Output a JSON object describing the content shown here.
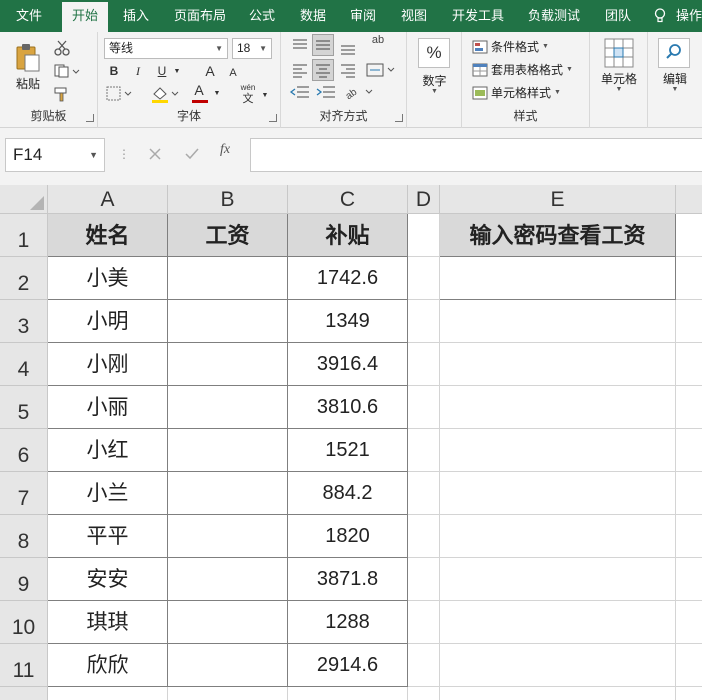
{
  "tabs": [
    "文件",
    "开始",
    "插入",
    "页面布局",
    "公式",
    "数据",
    "审阅",
    "视图",
    "开发工具",
    "负载测试",
    "团队",
    "操作"
  ],
  "active_tab": "开始",
  "clipboard": {
    "paste_label": "粘贴",
    "group_label": "剪贴板"
  },
  "font": {
    "name": "等线",
    "size": "18",
    "bold": "B",
    "italic": "I",
    "underline": "U",
    "grow": "A",
    "shrink": "A",
    "phonetic_top": "wén",
    "phonetic_bottom": "文",
    "font_color": "A",
    "group_label": "字体"
  },
  "alignment": {
    "wrap_icon": "ab",
    "group_label": "对齐方式"
  },
  "number": {
    "symbol": "%",
    "label": "数字"
  },
  "styles": {
    "conditional": "条件格式",
    "table_format": "套用表格格式",
    "cell_styles": "单元格样式",
    "group_label": "样式"
  },
  "cells": {
    "label": "单元格"
  },
  "editing": {
    "label": "编辑"
  },
  "formula_bar": {
    "name_box": "F14",
    "fx": "fx",
    "formula": ""
  },
  "columns": [
    "A",
    "B",
    "C",
    "D",
    "E"
  ],
  "table": {
    "headers": [
      "姓名",
      "工资",
      "补贴"
    ],
    "password_header": "输入密码查看工资",
    "rows": [
      {
        "row": "2",
        "name": "小美",
        "salary": "",
        "subsidy": "1742.6"
      },
      {
        "row": "3",
        "name": "小明",
        "salary": "",
        "subsidy": "1349"
      },
      {
        "row": "4",
        "name": "小刚",
        "salary": "",
        "subsidy": "3916.4"
      },
      {
        "row": "5",
        "name": "小丽",
        "salary": "",
        "subsidy": "3810.6"
      },
      {
        "row": "6",
        "name": "小红",
        "salary": "",
        "subsidy": "1521"
      },
      {
        "row": "7",
        "name": "小兰",
        "salary": "",
        "subsidy": "884.2"
      },
      {
        "row": "8",
        "name": "平平",
        "salary": "",
        "subsidy": "1820"
      },
      {
        "row": "9",
        "name": "安安",
        "salary": "",
        "subsidy": "3871.8"
      },
      {
        "row": "10",
        "name": "琪琪",
        "salary": "",
        "subsidy": "1288"
      },
      {
        "row": "11",
        "name": "欣欣",
        "salary": "",
        "subsidy": "2914.6"
      }
    ]
  },
  "row_header_1": "1"
}
